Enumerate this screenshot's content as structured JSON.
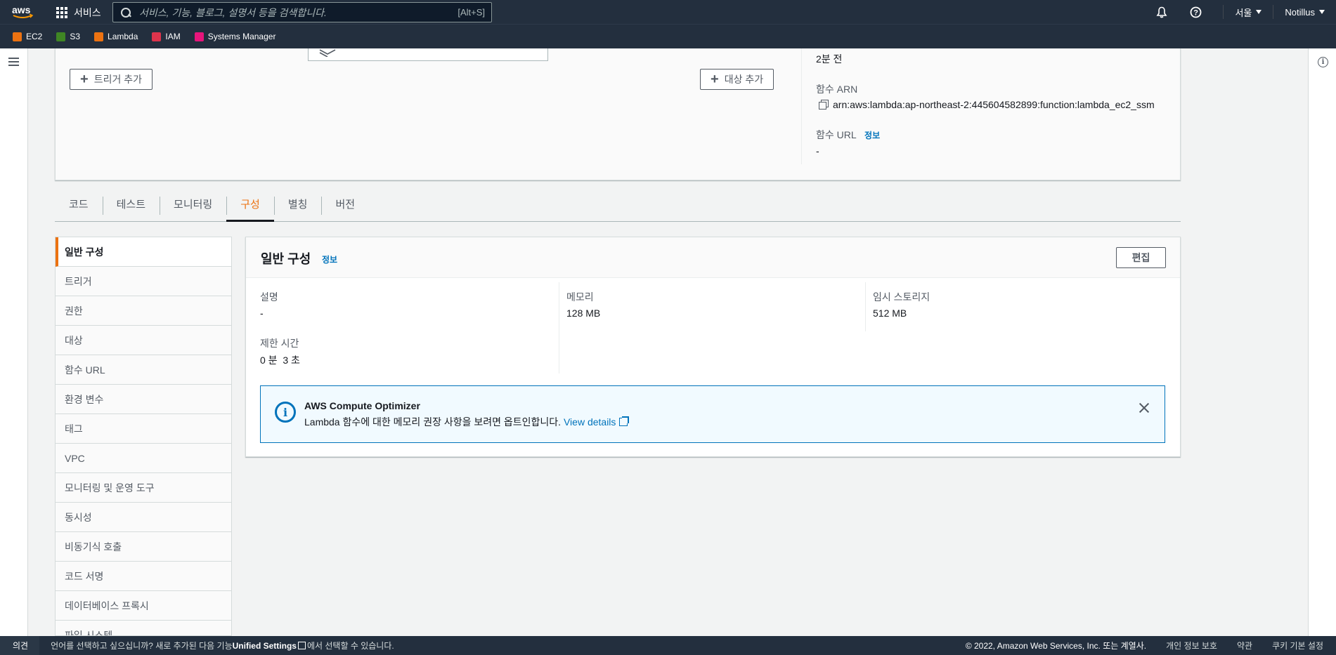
{
  "topnav": {
    "logo_text": "aws",
    "services_label": "서비스",
    "search_placeholder": "서비스, 기능, 블로그, 설명서 등을 검색합니다.",
    "search_shortcut": "[Alt+S]",
    "region": "서울",
    "account": "Notillus"
  },
  "favorites": [
    {
      "label": "EC2",
      "color": "#ec7211"
    },
    {
      "label": "S3",
      "color": "#3f8624"
    },
    {
      "label": "Lambda",
      "color": "#ec7211"
    },
    {
      "label": "IAM",
      "color": "#dd344c"
    },
    {
      "label": "Systems Manager",
      "color": "#e7157b"
    }
  ],
  "overview": {
    "add_trigger": "트리거 추가",
    "add_destination": "대상 추가",
    "last_modified": "2분 전",
    "arn_label": "함수 ARN",
    "arn_value": "arn:aws:lambda:ap-northeast-2:445604582899:function:lambda_ec2_ssm",
    "url_label": "함수 URL",
    "url_info": "정보",
    "url_value": "-"
  },
  "tabs": [
    {
      "label": "코드"
    },
    {
      "label": "테스트"
    },
    {
      "label": "모니터링"
    },
    {
      "label": "구성",
      "active": true
    },
    {
      "label": "별칭"
    },
    {
      "label": "버전"
    }
  ],
  "config_nav": [
    "일반 구성",
    "트리거",
    "권한",
    "대상",
    "함수 URL",
    "환경 변수",
    "태그",
    "VPC",
    "모니터링 및 운영 도구",
    "동시성",
    "비동기식 호출",
    "코드 서명",
    "데이터베이스 프록시",
    "파일 시스템"
  ],
  "general_config": {
    "title": "일반 구성",
    "info": "정보",
    "edit": "편집",
    "description_label": "설명",
    "description_value": "-",
    "memory_label": "메모리",
    "memory_value": "128 MB",
    "ephemeral_label": "임시 스토리지",
    "ephemeral_value": "512 MB",
    "timeout_label": "제한 시간",
    "timeout_value": "0 분  3 초"
  },
  "flash": {
    "title": "AWS Compute Optimizer",
    "body": "Lambda 함수에 대한 메모리 권장 사항을 보려면 옵트인합니다.",
    "link": "View details"
  },
  "footer": {
    "feedback": "의견",
    "message_pre": "언어를 선택하고 싶으십니까? 새로 추가된 다음 기능",
    "message_bold": "Unified Settings",
    "message_post": "에서 선택할 수 있습니다.",
    "copyright": "© 2022, Amazon Web Services, Inc. 또는 계열사.",
    "privacy": "개인 정보 보호",
    "terms": "약관",
    "cookies": "쿠키 기본 설정"
  }
}
